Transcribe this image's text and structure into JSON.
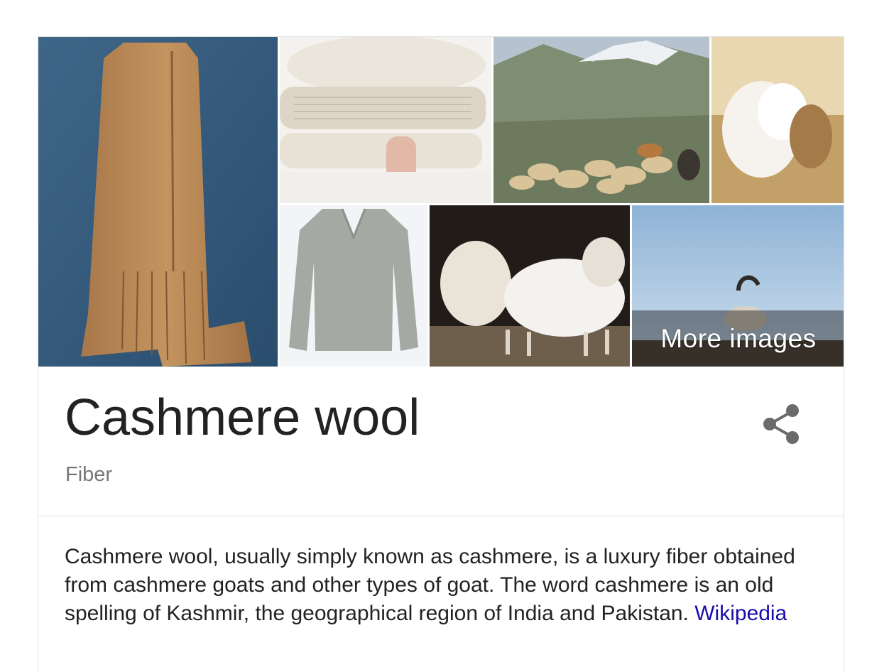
{
  "images": [
    {
      "id": "scarf",
      "description": "Tan cashmere scarf on blue fabric"
    },
    {
      "id": "folded-knits",
      "description": "Stack of folded cream knitwear held by a hand"
    },
    {
      "id": "goat-herd",
      "description": "Herd of goats in a mountain valley"
    },
    {
      "id": "raw-fiber",
      "description": "Tuft of white raw cashmere fiber"
    },
    {
      "id": "sweater",
      "description": "Grey V-neck sweater"
    },
    {
      "id": "white-goats",
      "description": "Long-haired white goats"
    },
    {
      "id": "ibex",
      "description": "Horned goat on a ridge against blue sky"
    }
  ],
  "more_images_label": "More images",
  "entity": {
    "title": "Cashmere wool",
    "subtitle": "Fiber"
  },
  "description": {
    "text": "Cashmere wool, usually simply known as cashmere, is a luxury fiber obtained from cashmere goats and other types of goat. The word cashmere is an old spelling of Kashmir, the geographical region of India and Pakistan. ",
    "source_link": "Wikipedia"
  },
  "icons": {
    "share": "share-icon"
  },
  "colors": {
    "title": "#222222",
    "subtitle": "#777777",
    "link": "#1a0dab"
  }
}
